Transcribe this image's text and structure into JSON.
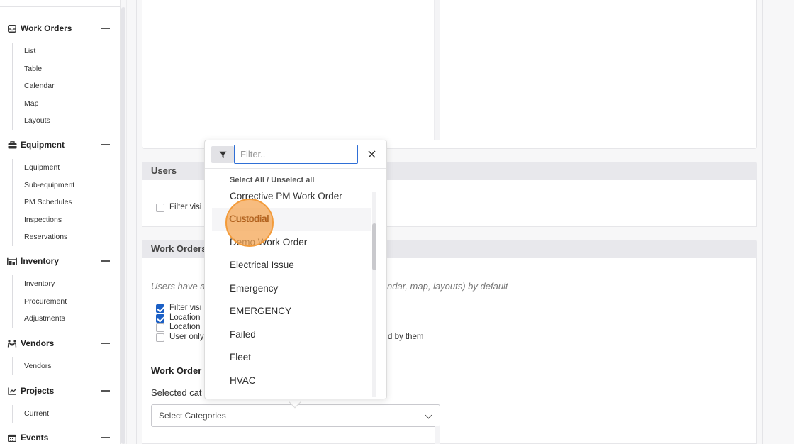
{
  "sidebar": {
    "sections": [
      {
        "label": "Work Orders",
        "icon": "inbox-icon",
        "items": [
          "List",
          "Table",
          "Calendar",
          "Map",
          "Layouts"
        ]
      },
      {
        "label": "Equipment",
        "icon": "toolbox-icon",
        "items": [
          "Equipment",
          "Sub-equipment",
          "PM Schedules",
          "Inspections",
          "Reservations"
        ]
      },
      {
        "label": "Inventory",
        "icon": "warehouse-icon",
        "items": [
          "Inventory",
          "Procurement",
          "Adjustments"
        ]
      },
      {
        "label": "Vendors",
        "icon": "people-carry-icon",
        "items": [
          "Vendors"
        ]
      },
      {
        "label": "Projects",
        "icon": "chart-icon",
        "items": [
          "Current"
        ]
      },
      {
        "label": "Events",
        "icon": "calendar-icon",
        "items": []
      }
    ]
  },
  "users_panel": {
    "title": "Users",
    "checkbox_label": "Filter visi"
  },
  "work_orders_panel": {
    "title": "Work Orders",
    "description_left": "Users have a",
    "description_right": "ndar, map, layouts) by default",
    "checkboxes": [
      {
        "label": "Filter visi",
        "checked": true
      },
      {
        "label": "Location",
        "checked": true
      },
      {
        "label": "Location",
        "checked": false
      },
      {
        "label": "User only",
        "checked": false
      }
    ],
    "user_only_tail": "d by them",
    "subheading": "Work Order",
    "selected_label": "Selected cat",
    "select_placeholder": "Select Categories"
  },
  "dropdown": {
    "filter_placeholder": "Filter..",
    "select_all": "Select All / Unselect all",
    "items": [
      "Corrective PM Work Order",
      "Custodial",
      "Demo Work Order",
      "Electrical Issue",
      "Emergency",
      "EMERGENCY",
      "Failed",
      "Fleet",
      "HVAC"
    ],
    "hovered": "Custodial"
  }
}
